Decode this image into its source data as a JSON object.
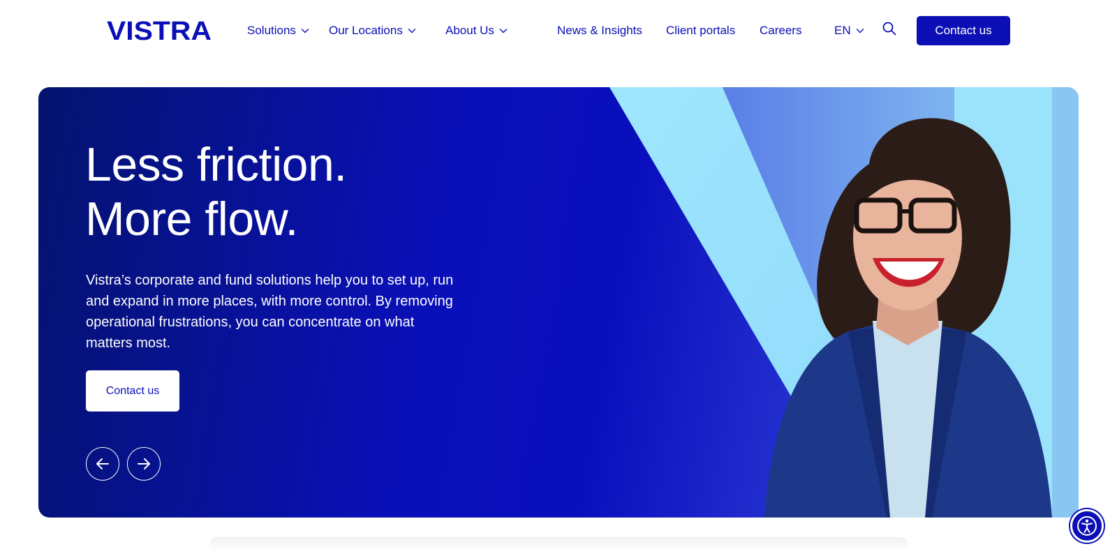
{
  "brand": {
    "name": "VISTRA",
    "color": "#0b0fb5"
  },
  "nav": {
    "solutions": "Solutions",
    "locations": "Our Locations",
    "about": "About Us",
    "news": "News & Insights",
    "client_portals": "Client portals",
    "careers": "Careers",
    "language": "EN",
    "contact": "Contact us"
  },
  "icons": {
    "search": "search-icon",
    "chevron": "chevron-down-icon",
    "prev": "arrow-left-icon",
    "next": "arrow-right-icon",
    "accessibility": "accessibility-icon"
  },
  "hero": {
    "headline_line1": "Less friction.",
    "headline_line2": "More flow.",
    "body": "Vistra’s corporate and fund solutions help you to set up, run and expand in more places, with more control. By removing operational frustrations, you can concentrate on what matters most.",
    "cta": "Contact us"
  },
  "colors": {
    "accent": "#0b0fb5",
    "hero_dark": "#04136e",
    "hero_light_stripe": "#9be3fb",
    "white": "#ffffff"
  }
}
